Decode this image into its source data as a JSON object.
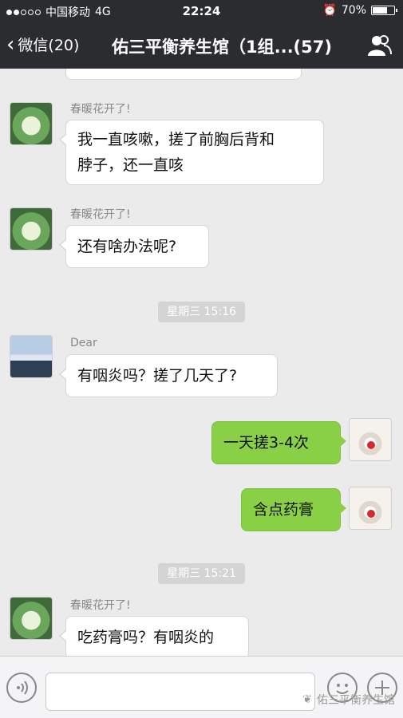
{
  "status_bar": {
    "carrier": "中国移动",
    "network": "4G",
    "time": "22:24",
    "battery": "70%",
    "battery_level": 0.7
  },
  "nav": {
    "back_label": "微信(20)",
    "title": "佑三平衡养生馆（1组...(57)"
  },
  "messages": [
    {
      "sender": "春暖花开了!",
      "lines": [
        "我一直咳嗽，搓了前胸后背和",
        "脖子，还一直咳"
      ]
    },
    {
      "sender": "春暖花开了!",
      "text": "还有啥办法呢?"
    },
    {
      "timestamp": "星期三 15:16"
    },
    {
      "sender": "Dear",
      "text": "有咽炎吗？搓了几天了?"
    },
    {
      "text": "一天搓3-4次"
    },
    {
      "text": "含点药膏"
    },
    {
      "timestamp": "星期三 15:21"
    },
    {
      "sender": "春暖花开了!",
      "text": "吃药膏吗？有咽炎的"
    }
  ],
  "watermark": "佑三平衡养生馆"
}
